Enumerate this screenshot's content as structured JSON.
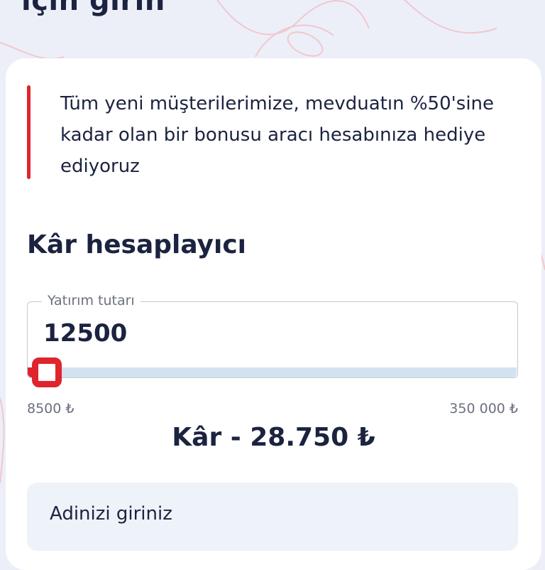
{
  "header": {
    "title": "için girin"
  },
  "promo": {
    "text": "Tüm yeni müşterilerimize, mevduatın %50'sine kadar olan bir bonusu aracı hesabınıza hediye ediyoruz"
  },
  "calculator": {
    "title": "Kâr hesaplayıcı",
    "amount_label": "Yatırım tutarı",
    "amount_value": "12500",
    "min_label": "8500 ₺",
    "max_label": "350 000 ₺",
    "min_value": 8500,
    "max_value": 350000,
    "current_value": 12500,
    "profit_text": "Kâr - 28.750 ₺"
  },
  "form": {
    "name_placeholder": "Adinizi giriniz"
  },
  "colors": {
    "accent": "#e0242e",
    "text": "#1b2340",
    "track": "#d3e2f0",
    "background": "#eceff8"
  }
}
